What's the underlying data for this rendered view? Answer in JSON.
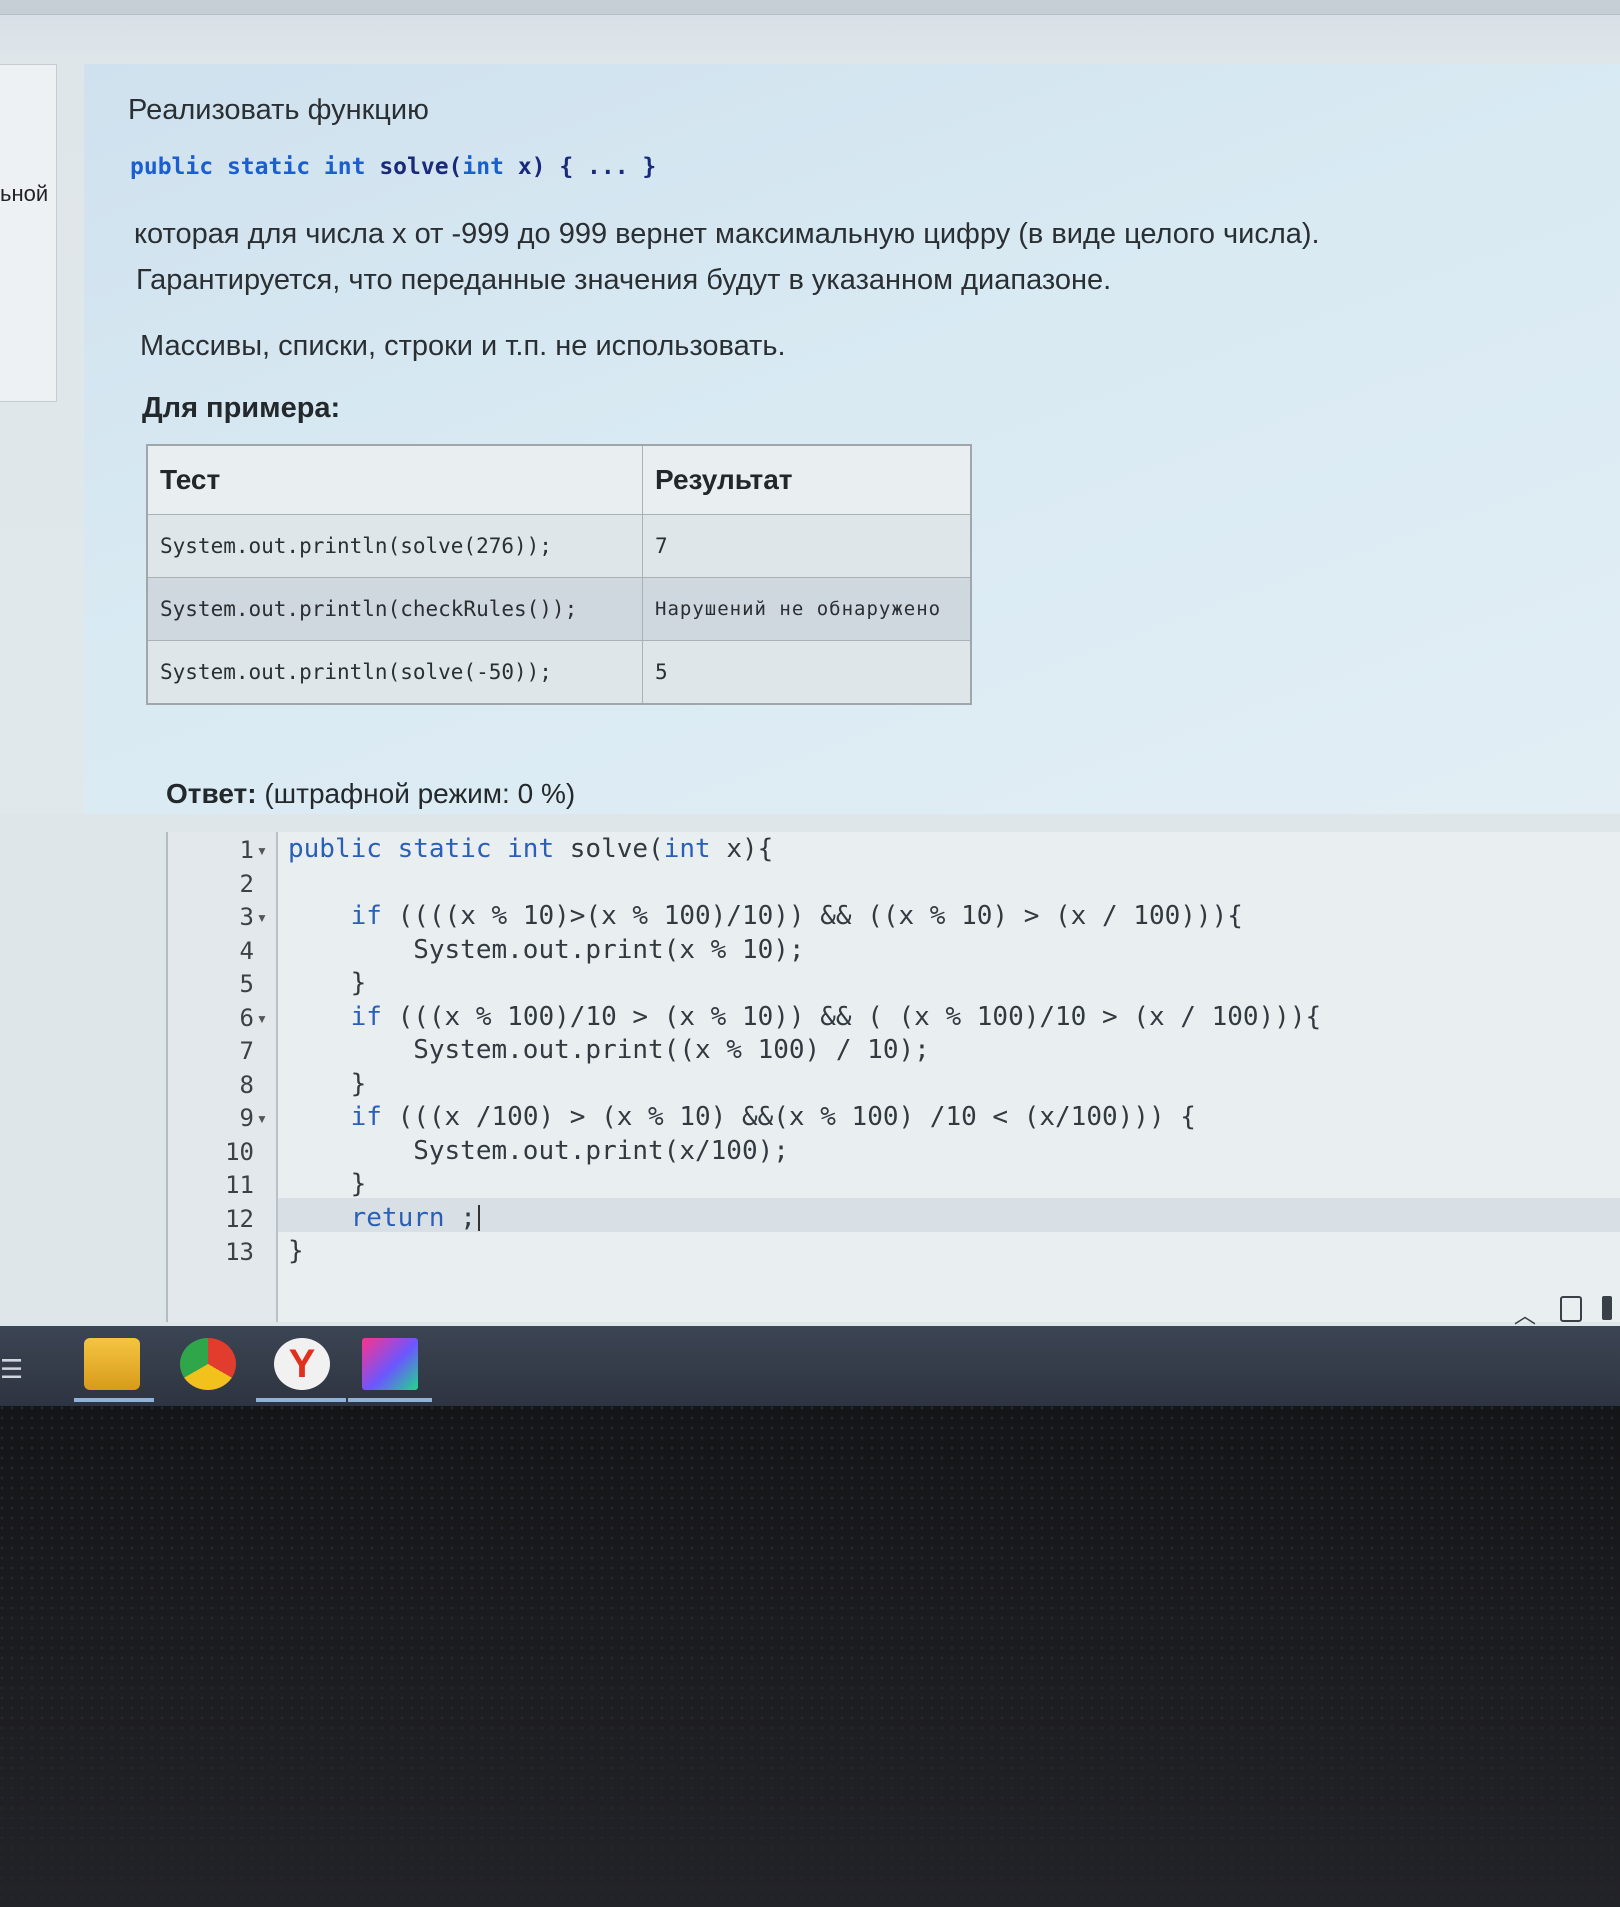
{
  "sidebar": {
    "partial_label": "ьной"
  },
  "question": {
    "title": "Реализовать функцию",
    "signature": {
      "kw1": "public",
      "kw2": "static",
      "kw3": "int",
      "rest1": "solve(",
      "kw4": "int",
      "rest2": "x) { ... }"
    },
    "description_line1": "которая для числа x от -999 до 999 вернет максимальную цифру (в виде целого числа).",
    "description_line2": "Гарантируется, что переданные значения будут в указанном диапазоне.",
    "restriction": "Массивы, списки, строки и т.п. не использовать.",
    "examples_title": "Для примера:",
    "examples_table": {
      "headers": [
        "Тест",
        "Результат"
      ],
      "rows": [
        [
          "System.out.println(solve(276));",
          "7"
        ],
        [
          "System.out.println(checkRules());",
          "Нарушений не обнаружено"
        ],
        [
          "System.out.println(solve(-50));",
          "5"
        ]
      ]
    }
  },
  "answer": {
    "label": "Ответ:",
    "penalty": "(штрафной режим: 0 %)",
    "line_numbers": [
      "1",
      "2",
      "3",
      "4",
      "5",
      "6",
      "7",
      "8",
      "9",
      "10",
      "11",
      "12",
      "13"
    ],
    "code_lines": [
      "public static int solve(int x){",
      "",
      "    if ((((x % 10)>(x % 100)/10)) && ((x % 10) > (x / 100))){",
      "        System.out.print(x % 10);",
      "    }",
      "    if (((x % 100)/10 > (x % 10)) && ( (x % 100)/10 > (x / 100))){",
      "        System.out.print((x % 100) / 10);",
      "    }",
      "    if (((x /100) > (x % 10) &&(x % 100) /10 < (x/100))) {",
      "        System.out.print(x/100);",
      "    }",
      "    return ;",
      "}"
    ],
    "active_line": 12
  },
  "taskbar": {
    "apps": [
      "file-explorer",
      "chrome",
      "yandex-browser",
      "intellij-idea"
    ]
  }
}
